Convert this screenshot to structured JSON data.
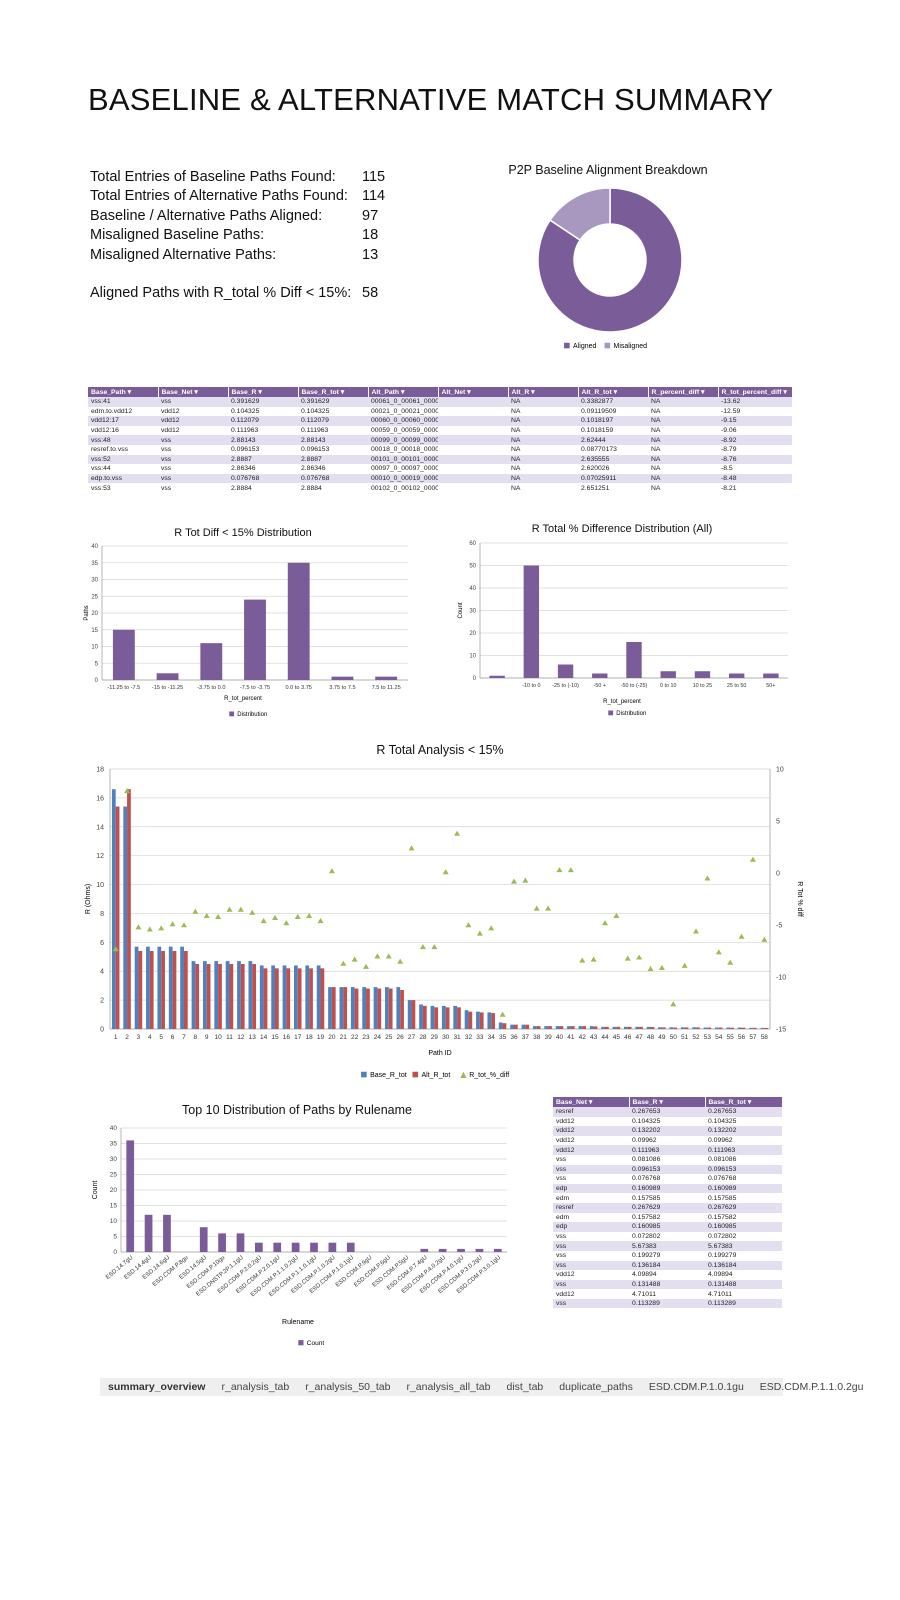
{
  "title": "BASELINE & ALTERNATIVE MATCH SUMMARY",
  "stats": [
    {
      "label": "Total Entries of Baseline Paths Found:",
      "value": "115"
    },
    {
      "label": "Total Entries of Alternative Paths Found:",
      "value": "114"
    },
    {
      "label": "Baseline / Alternative Paths Aligned:",
      "value": "97"
    },
    {
      "label": "Misaligned Baseline Paths:",
      "value": "18"
    },
    {
      "label": "Misaligned Alternative Paths:",
      "value": "13"
    }
  ],
  "stat_extra": {
    "label": "Aligned Paths with R_total % Diff < 15%:",
    "value": "58"
  },
  "colors": {
    "purple": "#7a5c99",
    "light_purple": "#a898c0",
    "blue": "#4f81bd",
    "red": "#c0504d",
    "green": "#9bbb59",
    "header": "#7a5c99",
    "band": "#e4dff0"
  },
  "donut": {
    "title": "P2P Baseline Alignment Breakdown",
    "legend": [
      "Aligned",
      "Misaligned"
    ],
    "values": [
      97,
      18
    ]
  },
  "table1": {
    "headers": [
      "Base_Path",
      "Base_Net",
      "Base_R",
      "Base_R_tot",
      "Alt_Path",
      "Alt_Net",
      "Alt_R",
      "Alt_R_tot",
      "R_percent_diff",
      "R_tot_percent_diff"
    ],
    "rows": [
      [
        "vss:41",
        "vss",
        "0.391629",
        "0.391629",
        "00061_0_00061_00000 vss",
        "",
        "NA",
        "0.3382877",
        "NA",
        "-13.62"
      ],
      [
        "edm.to.vdd12",
        "vdd12",
        "0.104325",
        "0.104325",
        "00021_0_00021_00000 vdd12",
        "",
        "NA",
        "0.09119509",
        "NA",
        "-12.59"
      ],
      [
        "vdd12:17",
        "vdd12",
        "0.112079",
        "0.112079",
        "00060_0_00060_00000 vdd12",
        "",
        "NA",
        "0.1018197",
        "NA",
        "-9.15"
      ],
      [
        "vdd12:16",
        "vdd12",
        "0.111963",
        "0.111963",
        "00059_0_00059_00000 vdd12",
        "",
        "NA",
        "0.1018159",
        "NA",
        "-9.06"
      ],
      [
        "vss:48",
        "vss",
        "2.88143",
        "2.88143",
        "00099_0_00099_00000 vss",
        "",
        "NA",
        "2.62444",
        "NA",
        "-8.92"
      ],
      [
        "resref.to.vss",
        "vss",
        "0.096153",
        "0.096153",
        "00018_0_00018_00000 vss",
        "",
        "NA",
        "0.08770173",
        "NA",
        "-8.79"
      ],
      [
        "vss:52",
        "vss",
        "2.8887",
        "2.8887",
        "00101_0_00101_00000 vss",
        "",
        "NA",
        "2.635555",
        "NA",
        "-8.76"
      ],
      [
        "vss:44",
        "vss",
        "2.86346",
        "2.86346",
        "00097_0_00097_00000 vss",
        "",
        "NA",
        "2.620026",
        "NA",
        "-8.5"
      ],
      [
        "edp.to.vss",
        "vss",
        "0.076768",
        "0.076768",
        "00010_0_00019_00000 vss",
        "",
        "NA",
        "0.07025911",
        "NA",
        "-8.48"
      ],
      [
        "vss:53",
        "vss",
        "2.8884",
        "2.8884",
        "00102_0_00102_00000 vss",
        "",
        "NA",
        "2.651251",
        "NA",
        "-8.21"
      ]
    ]
  },
  "table2": {
    "headers": [
      "Base_Net",
      "Base_R",
      "Base_R_tot"
    ],
    "rows": [
      [
        "resref",
        "0.267653",
        "0.267653"
      ],
      [
        "vdd12",
        "0.104325",
        "0.104325"
      ],
      [
        "vdd12",
        "0.132202",
        "0.132202"
      ],
      [
        "vdd12",
        "0.09962",
        "0.09962"
      ],
      [
        "vdd12",
        "0.111963",
        "0.111963"
      ],
      [
        "vss",
        "0.081086",
        "0.081086"
      ],
      [
        "vss",
        "0.096153",
        "0.096153"
      ],
      [
        "vss",
        "0.076768",
        "0.076768"
      ],
      [
        "edp",
        "0.160989",
        "0.160989"
      ],
      [
        "edm",
        "0.157585",
        "0.157585"
      ],
      [
        "resref",
        "0.267629",
        "0.267629"
      ],
      [
        "edm",
        "0.157582",
        "0.157582"
      ],
      [
        "edp",
        "0.160985",
        "0.160985"
      ],
      [
        "vss",
        "0.072802",
        "0.072802"
      ],
      [
        "vss",
        "5.67383",
        "5.67383"
      ],
      [
        "vss",
        "0.199279",
        "0.199279"
      ],
      [
        "vss",
        "0.136184",
        "0.136184"
      ],
      [
        "vdd12",
        "4.09894",
        "4.09894"
      ],
      [
        "vss",
        "0.131488",
        "0.131488"
      ],
      [
        "vdd12",
        "4.71011",
        "4.71011"
      ],
      [
        "vss",
        "0.113289",
        "0.113289"
      ]
    ]
  },
  "tabs": [
    "summary_overview",
    "r_analysis_tab",
    "r_analysis_50_tab",
    "r_analysis_all_tab",
    "dist_tab",
    "duplicate_paths",
    "ESD.CDM.P.1.0.1gu",
    "ESD.CDM.P.1.1.0.2gu"
  ],
  "chart_data": [
    {
      "type": "pie",
      "title": "P2P Baseline Alignment Breakdown",
      "categories": [
        "Aligned",
        "Misaligned"
      ],
      "values": [
        97,
        18
      ],
      "legend": "bottom"
    },
    {
      "type": "bar",
      "title": "R Tot Diff < 15% Distribution",
      "xlabel": "R_tot_percent",
      "ylabel": "Paths",
      "categories": [
        "-11.25 to -7.5",
        "-15 to -11.25",
        "-3.75 to 0.0",
        "-7.5 to -3.75",
        "0.0 to 3.75",
        "3.75 to 7.5",
        "7.5 to 11.25"
      ],
      "series": [
        {
          "name": "Distribution",
          "values": [
            15,
            2,
            11,
            24,
            35,
            1,
            1
          ]
        }
      ],
      "ylim": [
        0,
        40
      ],
      "yticks": [
        0,
        5,
        10,
        15,
        20,
        25,
        30,
        35,
        40
      ],
      "grid": true,
      "legend": "bottom"
    },
    {
      "type": "bar",
      "title": "R Total % Difference Distribution (All)",
      "xlabel": "R_tot_percent",
      "ylabel": "Count",
      "categories": [
        "",
        "-10 to 0",
        "-25 to (-10)",
        "-50 +",
        "-50 to (-25)",
        "0 to 10",
        "10 to 25",
        "25 to 50",
        "50+"
      ],
      "series": [
        {
          "name": "Distribution",
          "values": [
            1,
            50,
            6,
            2,
            16,
            3,
            3,
            2,
            2
          ]
        }
      ],
      "ylim": [
        0,
        60
      ],
      "yticks": [
        0,
        10,
        20,
        30,
        40,
        50,
        60
      ],
      "grid": true,
      "legend": "bottom"
    },
    {
      "type": "bar",
      "title": "R Total Analysis < 15%",
      "xlabel": "Path ID",
      "ylabel": "R (Ohms)",
      "y2label": "R Tot % diff",
      "categories": [
        "1",
        "2",
        "3",
        "4",
        "5",
        "6",
        "7",
        "8",
        "9",
        "10",
        "11",
        "12",
        "13",
        "14",
        "15",
        "16",
        "17",
        "18",
        "19",
        "20",
        "21",
        "22",
        "23",
        "24",
        "25",
        "26",
        "27",
        "28",
        "29",
        "30",
        "31",
        "32",
        "33",
        "34",
        "35",
        "36",
        "37",
        "38",
        "39",
        "40",
        "41",
        "42",
        "43",
        "44",
        "45",
        "46",
        "47",
        "48",
        "49",
        "50",
        "51",
        "52",
        "53",
        "54",
        "55",
        "56",
        "57",
        "58"
      ],
      "series": [
        {
          "name": "Base_R_tot",
          "values": [
            16.6,
            15.4,
            5.7,
            5.7,
            5.7,
            5.7,
            5.7,
            4.7,
            4.7,
            4.7,
            4.7,
            4.7,
            4.7,
            4.4,
            4.4,
            4.4,
            4.4,
            4.4,
            4.4,
            2.9,
            2.9,
            2.9,
            2.9,
            2.9,
            2.9,
            2.9,
            2.0,
            1.7,
            1.6,
            1.6,
            1.6,
            1.3,
            1.2,
            1.15,
            0.45,
            0.3,
            0.3,
            0.2,
            0.2,
            0.2,
            0.2,
            0.2,
            0.2,
            0.15,
            0.15,
            0.15,
            0.15,
            0.15,
            0.12,
            0.12,
            0.12,
            0.12,
            0.1,
            0.1,
            0.1,
            0.1,
            0.08,
            0.08
          ]
        },
        {
          "name": "Alt_R_tot",
          "values": [
            15.4,
            16.6,
            5.4,
            5.4,
            5.4,
            5.4,
            5.4,
            4.5,
            4.5,
            4.5,
            4.5,
            4.5,
            4.5,
            4.2,
            4.2,
            4.2,
            4.2,
            4.2,
            4.2,
            2.9,
            2.9,
            2.8,
            2.8,
            2.8,
            2.8,
            2.7,
            2.0,
            1.6,
            1.5,
            1.5,
            1.5,
            1.2,
            1.15,
            1.1,
            0.4,
            0.3,
            0.3,
            0.2,
            0.2,
            0.2,
            0.2,
            0.2,
            0.18,
            0.15,
            0.15,
            0.15,
            0.15,
            0.14,
            0.11,
            0.1,
            0.11,
            0.11,
            0.1,
            0.1,
            0.09,
            0.09,
            0.08,
            0.07
          ]
        },
        {
          "name": "R_tot_%_diff",
          "axis": "right",
          "values": [
            -7.3,
            7.9,
            -5.2,
            -5.4,
            -5.3,
            -4.9,
            -5.0,
            -3.7,
            -4.1,
            -4.2,
            -3.5,
            -3.5,
            -3.8,
            -4.6,
            -4.3,
            -4.8,
            -4.2,
            -4.1,
            -4.6,
            0.2,
            -8.7,
            -8.3,
            -9.0,
            -8.0,
            -8.0,
            -8.5,
            2.4,
            -7.1,
            -7.1,
            0.1,
            3.8,
            -5.0,
            -5.8,
            -5.3,
            -13.6,
            -0.8,
            -0.7,
            -3.4,
            -3.4,
            0.3,
            0.3,
            -8.4,
            -8.3,
            -4.8,
            -4.1,
            -8.2,
            -8.1,
            -9.2,
            -9.1,
            -12.6,
            -8.9,
            -5.6,
            -0.5,
            -7.6,
            -8.6,
            -6.1,
            1.3,
            -6.4
          ]
        }
      ],
      "ylim": [
        0,
        18
      ],
      "yticks": [
        0,
        2,
        4,
        6,
        8,
        10,
        12,
        14,
        16,
        18
      ],
      "y2lim": [
        -15,
        10
      ],
      "y2ticks": [
        -15,
        -10,
        -5,
        0,
        5,
        10
      ],
      "grid": true,
      "legend": "bottom"
    },
    {
      "type": "bar",
      "title": "Top 10 Distribution of Paths by Rulename",
      "xlabel": "Rulename",
      "ylabel": "Count",
      "categories": [
        "ESD.14.7gU",
        "ESD.14.4gU",
        "ESD.14.6gU",
        "ESD.CDM.P.8gu",
        "ESD.14.5gU",
        "ESD.CDM.P.10gu",
        "ESD.DNSTP.2P.1.1gU",
        "ESD.CDM.P.2.0.2gU",
        "ESD.CDM.P.2.0.1gU",
        "ESD.CDM.P.1.1.0.2gU",
        "ESD.CDM.P.1.1.0.1gU",
        "ESD.CDM.P.1.0.2gU",
        "ESD.CDM.P.1.0.1gU",
        "ESD.CDM.P.9gU",
        "ESD.CDM.P.6gU",
        "ESD.CDM.P.5gU",
        "ESD.CDM.P.7.4gU",
        "ESD.CDM.P.4.0.2gU",
        "ESD.CDM.P.4.0.1gU",
        "ESD.CDM.P.3.0.2gU",
        "ESD.CDM.P.3.0.1gU"
      ],
      "series": [
        {
          "name": "Count",
          "values": [
            36,
            12,
            12,
            0,
            8,
            6,
            6,
            3,
            3,
            3,
            3,
            3,
            3,
            0,
            0,
            0,
            1,
            1,
            1,
            1,
            1
          ]
        }
      ],
      "ylim": [
        0,
        40
      ],
      "yticks": [
        0,
        5,
        10,
        15,
        20,
        25,
        30,
        35,
        40
      ],
      "grid": true,
      "legend": "bottom"
    }
  ]
}
